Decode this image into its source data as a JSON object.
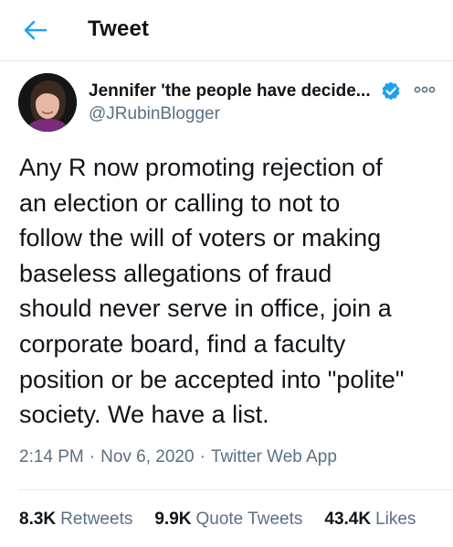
{
  "header": {
    "title": "Tweet",
    "back_icon": "arrow-left-icon",
    "accent_color": "#1da1f2"
  },
  "tweet": {
    "author": {
      "name": "Jennifer 'the people have decide...",
      "handle": "@JRubinBlogger",
      "verified": true,
      "verified_icon": "verified-badge-icon"
    },
    "more_icon": "more-options-icon",
    "text_lines": [
      "Any R now promoting rejection of",
      "an election or calling to not to",
      "follow the will of voters or making",
      "baseless allegations of fraud",
      "should never serve in office, join a",
      "corporate board, find a faculty",
      "position or be accepted into \"polite\"",
      "society. We have a list."
    ],
    "time": "2:14 PM",
    "date": "Nov 6, 2020",
    "source": "Twitter Web App",
    "separator": "·"
  },
  "stats": [
    {
      "count": "8.3K",
      "label": "Retweets"
    },
    {
      "count": "9.9K",
      "label": "Quote Tweets"
    },
    {
      "count": "43.4K",
      "label": "Likes"
    }
  ]
}
